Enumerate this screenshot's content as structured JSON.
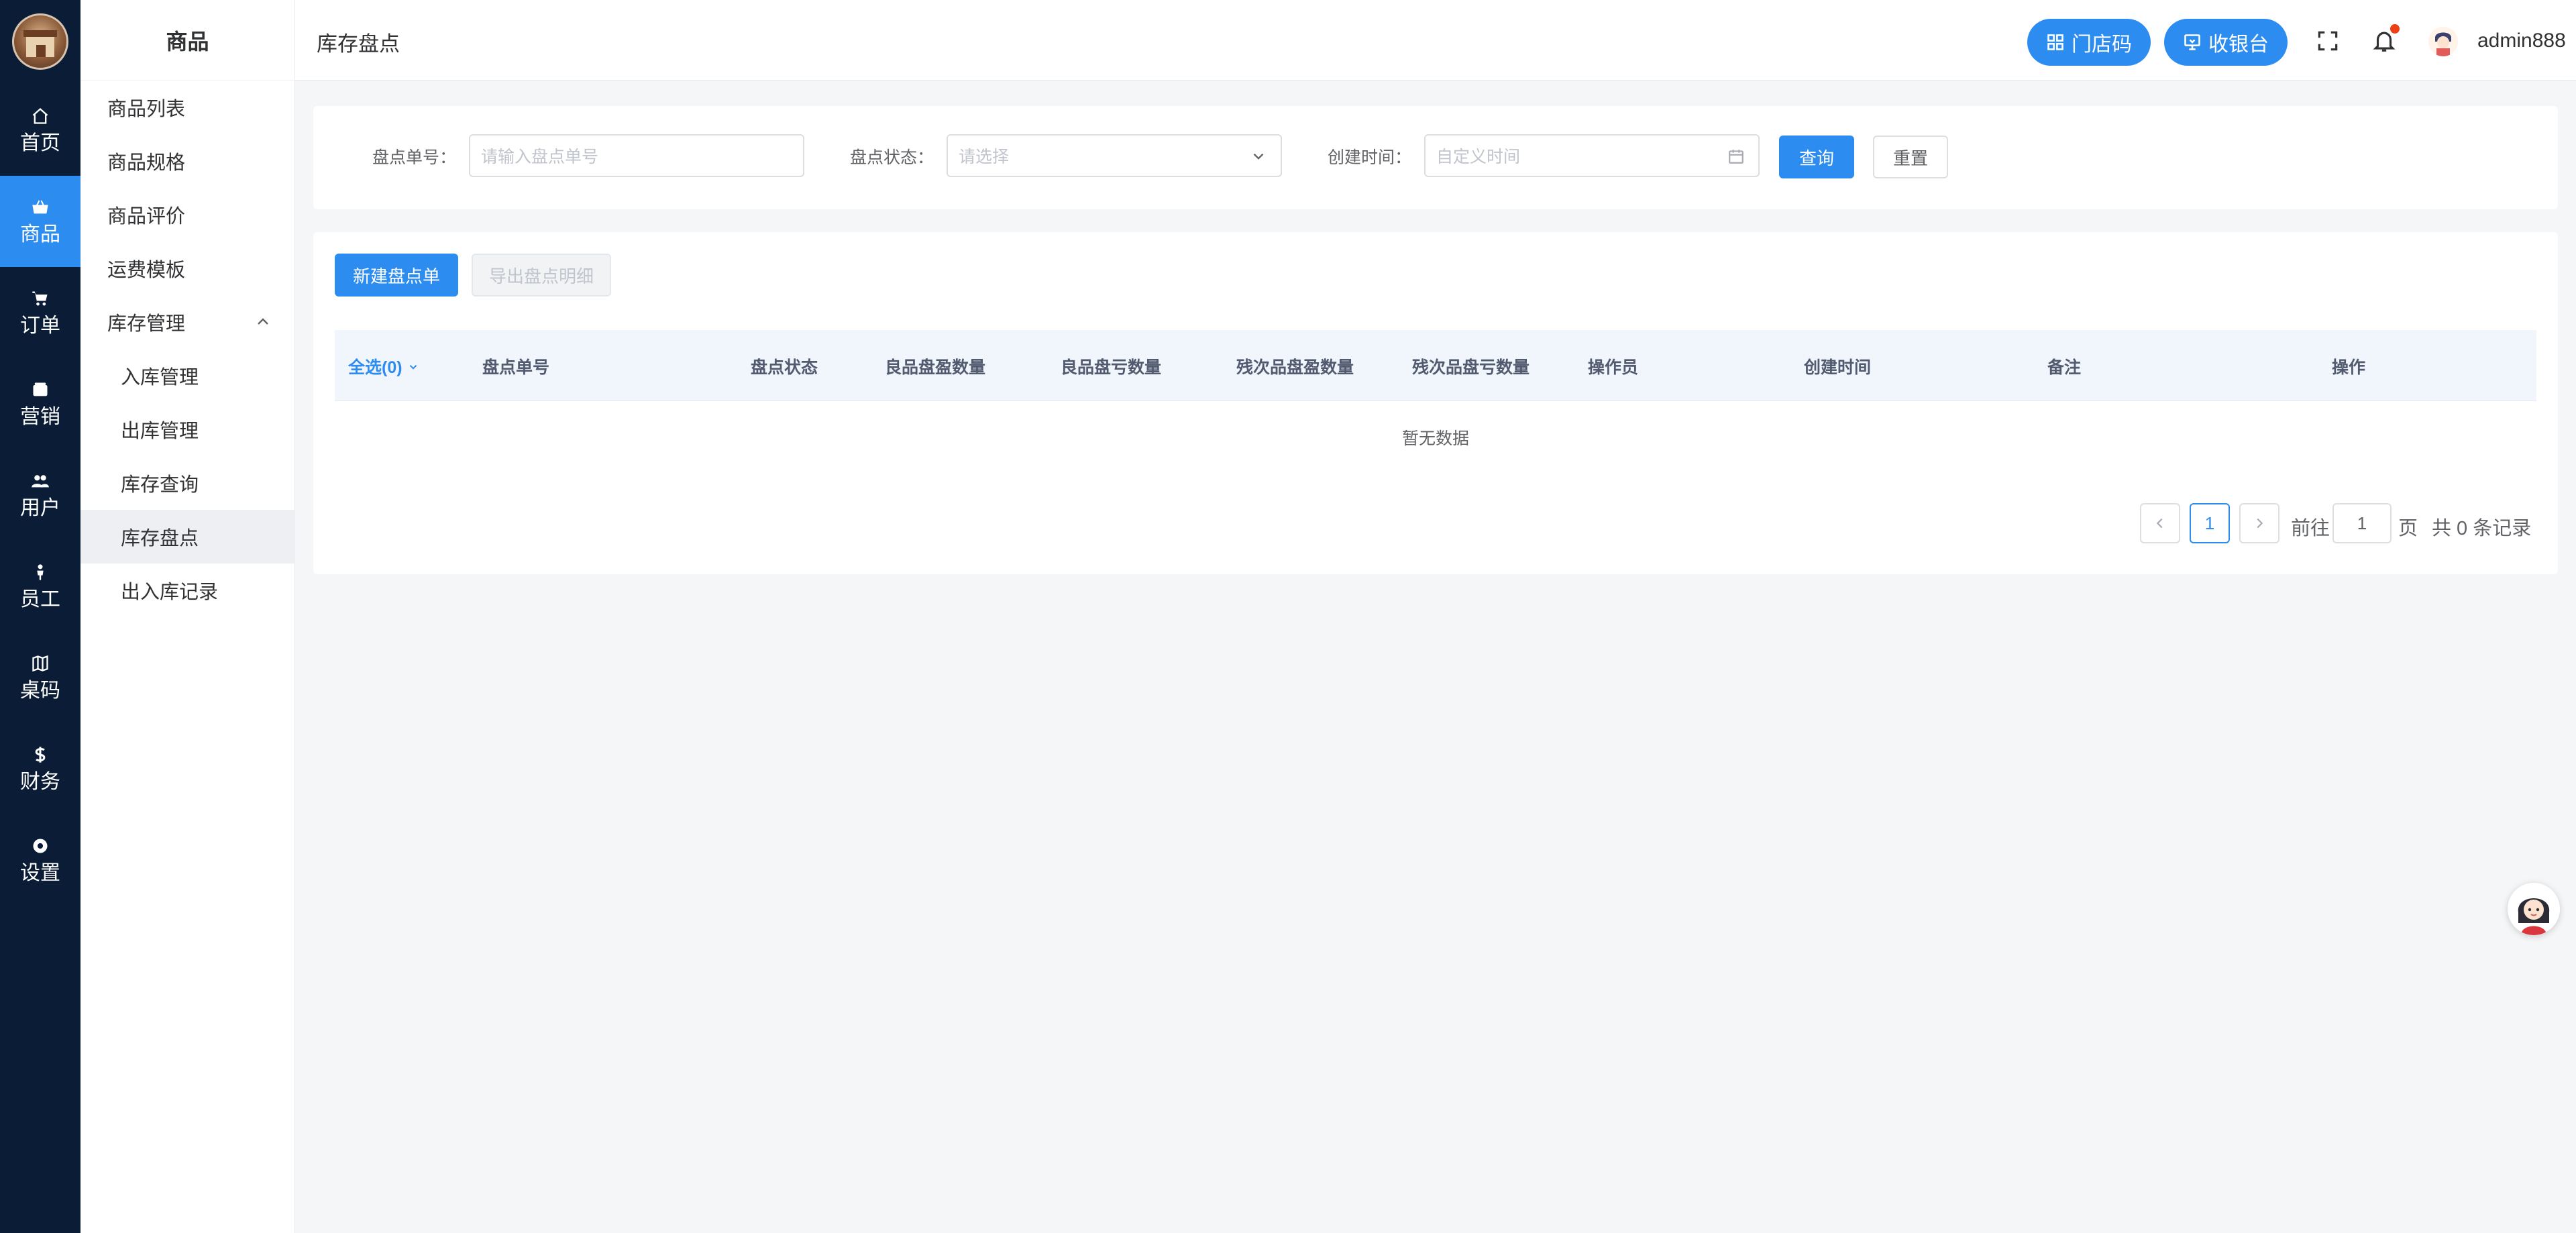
{
  "rail": {
    "items": [
      {
        "label": "首页",
        "icon": "home-icon"
      },
      {
        "label": "商品",
        "icon": "basket-icon"
      },
      {
        "label": "订单",
        "icon": "cart-icon"
      },
      {
        "label": "营销",
        "icon": "wallet-icon"
      },
      {
        "label": "用户",
        "icon": "users-icon"
      },
      {
        "label": "员工",
        "icon": "person-icon"
      },
      {
        "label": "桌码",
        "icon": "map-icon"
      },
      {
        "label": "财务",
        "icon": "dollar-icon"
      },
      {
        "label": "设置",
        "icon": "gear-icon"
      }
    ],
    "active_index": 1,
    "accent": "#2d8cf0",
    "background": "#0b1d36"
  },
  "submenu": {
    "title": "商品",
    "items": [
      {
        "label": "商品列表"
      },
      {
        "label": "商品规格"
      },
      {
        "label": "商品评价"
      },
      {
        "label": "运费模板"
      },
      {
        "label": "库存管理",
        "expanded": true
      },
      {
        "label": "入库管理"
      },
      {
        "label": "出库管理"
      },
      {
        "label": "库存查询"
      },
      {
        "label": "库存盘点",
        "active": true
      },
      {
        "label": "出入库记录"
      }
    ]
  },
  "header": {
    "page_title": "库存盘点",
    "store_code_label": "门店码",
    "cashier_label": "收银台",
    "username": "admin888"
  },
  "search": {
    "order_no_label": "盘点单号：",
    "order_no_placeholder": "请输入盘点单号",
    "status_label": "盘点状态：",
    "status_placeholder": "请选择",
    "created_label": "创建时间：",
    "created_placeholder": "自定义时间",
    "query_label": "查询",
    "reset_label": "重置"
  },
  "actions": {
    "new_label": "新建盘点单",
    "export_label": "导出盘点明细",
    "export_disabled": true
  },
  "table": {
    "select_all": "全选(0)",
    "columns": [
      "盘点单号",
      "盘点状态",
      "良品盘盈数量",
      "良品盘亏数量",
      "残次品盘盈数量",
      "残次品盘亏数量",
      "操作员",
      "创建时间",
      "备注",
      "操作"
    ],
    "rows": [],
    "empty_text": "暂无数据"
  },
  "pagination": {
    "current_page": "1",
    "goto_prefix": "前往",
    "goto_value": "1",
    "goto_suffix": "页",
    "total_text": "共 0 条记录"
  }
}
